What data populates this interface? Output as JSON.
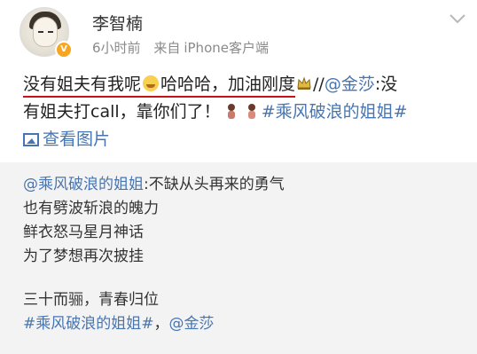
{
  "user": {
    "name": "李智楠",
    "time": "6小时前",
    "source_prefix": "来自",
    "source": "iPhone客户端"
  },
  "post": {
    "underlined": "没有姐夫有我呢",
    "after_emoji": "哈哈哈，加油刚度",
    "repost_sep": "//",
    "mention": "@金莎",
    "line1_tail": ":没",
    "line2_text": "有姐夫打call，靠你们了！",
    "hashtag": "#乘风破浪的姐姐#",
    "view_images": "查看图片"
  },
  "quote": {
    "mention": "@乘风破浪的姐姐",
    "line1_tail": ":不缺从头再来的勇气",
    "line2": "也有劈波斩浪的魄力",
    "line3": "鲜衣怒马星月神话",
    "line4": "为了梦想再次披挂",
    "line5": "三十而骊，青春归位",
    "hashtag": "#乘风破浪的姐姐#",
    "sep": "，",
    "mention2": "@金莎"
  },
  "colors": {
    "link": "#4775b2",
    "underline": "#c4141a",
    "quote_bg": "#f3f3f3",
    "meta": "#8a8a8a"
  },
  "icons": [
    "avatar",
    "verified-badge",
    "chevron-down-icon",
    "grin-emoji-icon",
    "crown-emoji-icon",
    "people-emoji-icon",
    "image-icon"
  ]
}
